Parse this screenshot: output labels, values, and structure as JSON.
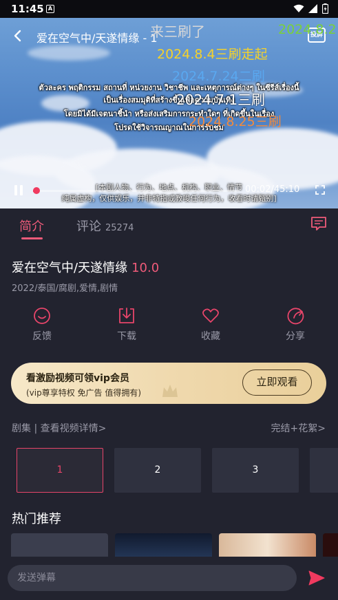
{
  "status": {
    "time": "11:45",
    "app_badge": "A"
  },
  "video": {
    "title": "爱在空气中/天遂情缘 - 1",
    "cast_label": "投屏",
    "danmaku": [
      {
        "text": "来三刷了",
        "color": "#d8d8d8"
      },
      {
        "text": "2024.8.2",
        "color": "#7ad03a"
      },
      {
        "text": "2024.8.4三刷走起",
        "color": "#f5d22a"
      },
      {
        "text": "2024.7.24二刷",
        "color": "#5aa8f0"
      },
      {
        "text": "2024.7.1三刷",
        "color": "#ffffff"
      },
      {
        "text": "2024.8.25三刷",
        "color": "#f28a3c"
      }
    ],
    "thai_lines": [
      "ตัวละคร พฤติกรรม สถานที่ หน่วยงาน วิชาชีพ และเหตุการณ์ต่างๆ ในซีรีส์เรื่องนี้",
      "เป็นเรื่องสมมุติที่สร้างขึ้นเพื่อความบันเทิง",
      "โดยมิได้มีเจตนาชี้นำ หรือส่งเสริมการกระทำใดๆ ที่เกิดขึ้นในเรื่อง",
      "โปรดใช้วิจารณญาณในการรับชม"
    ],
    "notice_lines": [
      "[本剧人物、行为、地点、机构、职业、情节",
      "纯属虚构，仅供娱乐，并非特指或教唆任何行为，收看时请甄别]"
    ],
    "time": "00:02/45:10",
    "progress": 0.001
  },
  "tabs": {
    "intro": "简介",
    "comments": "评论",
    "comments_count": "25274"
  },
  "show": {
    "title": "爱在空气中/天遂情缘",
    "score": "10.0",
    "meta": "2022/泰国/腐剧,爱情,剧情"
  },
  "actions": [
    {
      "label": "反馈",
      "icon": "feedback-icon"
    },
    {
      "label": "下载",
      "icon": "download-icon"
    },
    {
      "label": "收藏",
      "icon": "heart-icon"
    },
    {
      "label": "分享",
      "icon": "share-icon"
    }
  ],
  "vip": {
    "title": "看激励视频可领vip会员",
    "subtitle": "(vip尊享特权 免广告 值得拥有)",
    "button": "立即观看"
  },
  "episodes_header": {
    "left": "剧集 | 查看视频详情>",
    "right": "完结+花絮>"
  },
  "episodes": [
    "1",
    "2",
    "3"
  ],
  "hot": {
    "title": "热门推荐"
  },
  "danmu_input": {
    "placeholder": "发送弹幕"
  },
  "colors": {
    "accent": "#f05b7a",
    "background": "#22232f",
    "vip_gold": "#efd8ac"
  }
}
